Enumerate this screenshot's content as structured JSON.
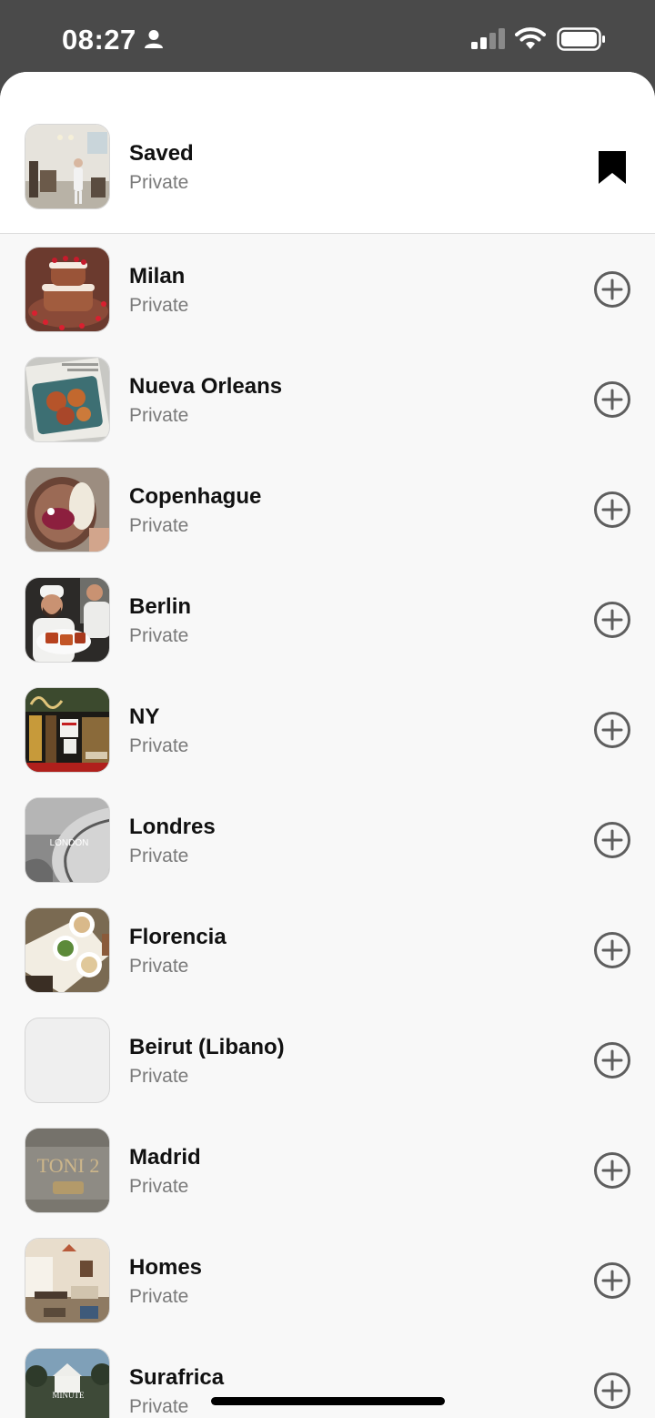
{
  "status_bar": {
    "time": "08:27",
    "icons": [
      "person-icon",
      "signal-icon",
      "wifi-icon",
      "battery-icon"
    ]
  },
  "saved": {
    "title": "Saved",
    "subtitle": "Private",
    "action_icon": "bookmark-icon"
  },
  "collections": [
    {
      "title": "Milan",
      "subtitle": "Private",
      "action_icon": "add-circle-icon"
    },
    {
      "title": "Nueva Orleans",
      "subtitle": "Private",
      "action_icon": "add-circle-icon"
    },
    {
      "title": "Copenhague",
      "subtitle": "Private",
      "action_icon": "add-circle-icon"
    },
    {
      "title": "Berlin",
      "subtitle": "Private",
      "action_icon": "add-circle-icon"
    },
    {
      "title": "NY",
      "subtitle": "Private",
      "action_icon": "add-circle-icon"
    },
    {
      "title": "Londres",
      "subtitle": "Private",
      "action_icon": "add-circle-icon"
    },
    {
      "title": "Florencia",
      "subtitle": "Private",
      "action_icon": "add-circle-icon"
    },
    {
      "title": "Beirut (Libano)",
      "subtitle": "Private",
      "action_icon": "add-circle-icon"
    },
    {
      "title": "Madrid",
      "subtitle": "Private",
      "action_icon": "add-circle-icon"
    },
    {
      "title": "Homes",
      "subtitle": "Private",
      "action_icon": "add-circle-icon"
    },
    {
      "title": "Surafrica",
      "subtitle": "Private",
      "action_icon": "add-circle-icon"
    }
  ],
  "thumbnail_text": {
    "londres": "LONDON",
    "madrid": "TONI 2",
    "surafrica": "MINUTE"
  },
  "colors": {
    "status_bar_bg": "#4a4a4a",
    "sheet_bg": "#f8f8f8",
    "saved_row_bg": "#ffffff",
    "title": "#111111",
    "subtitle": "#7a7a7a",
    "add_icon": "#5e5e5e"
  }
}
